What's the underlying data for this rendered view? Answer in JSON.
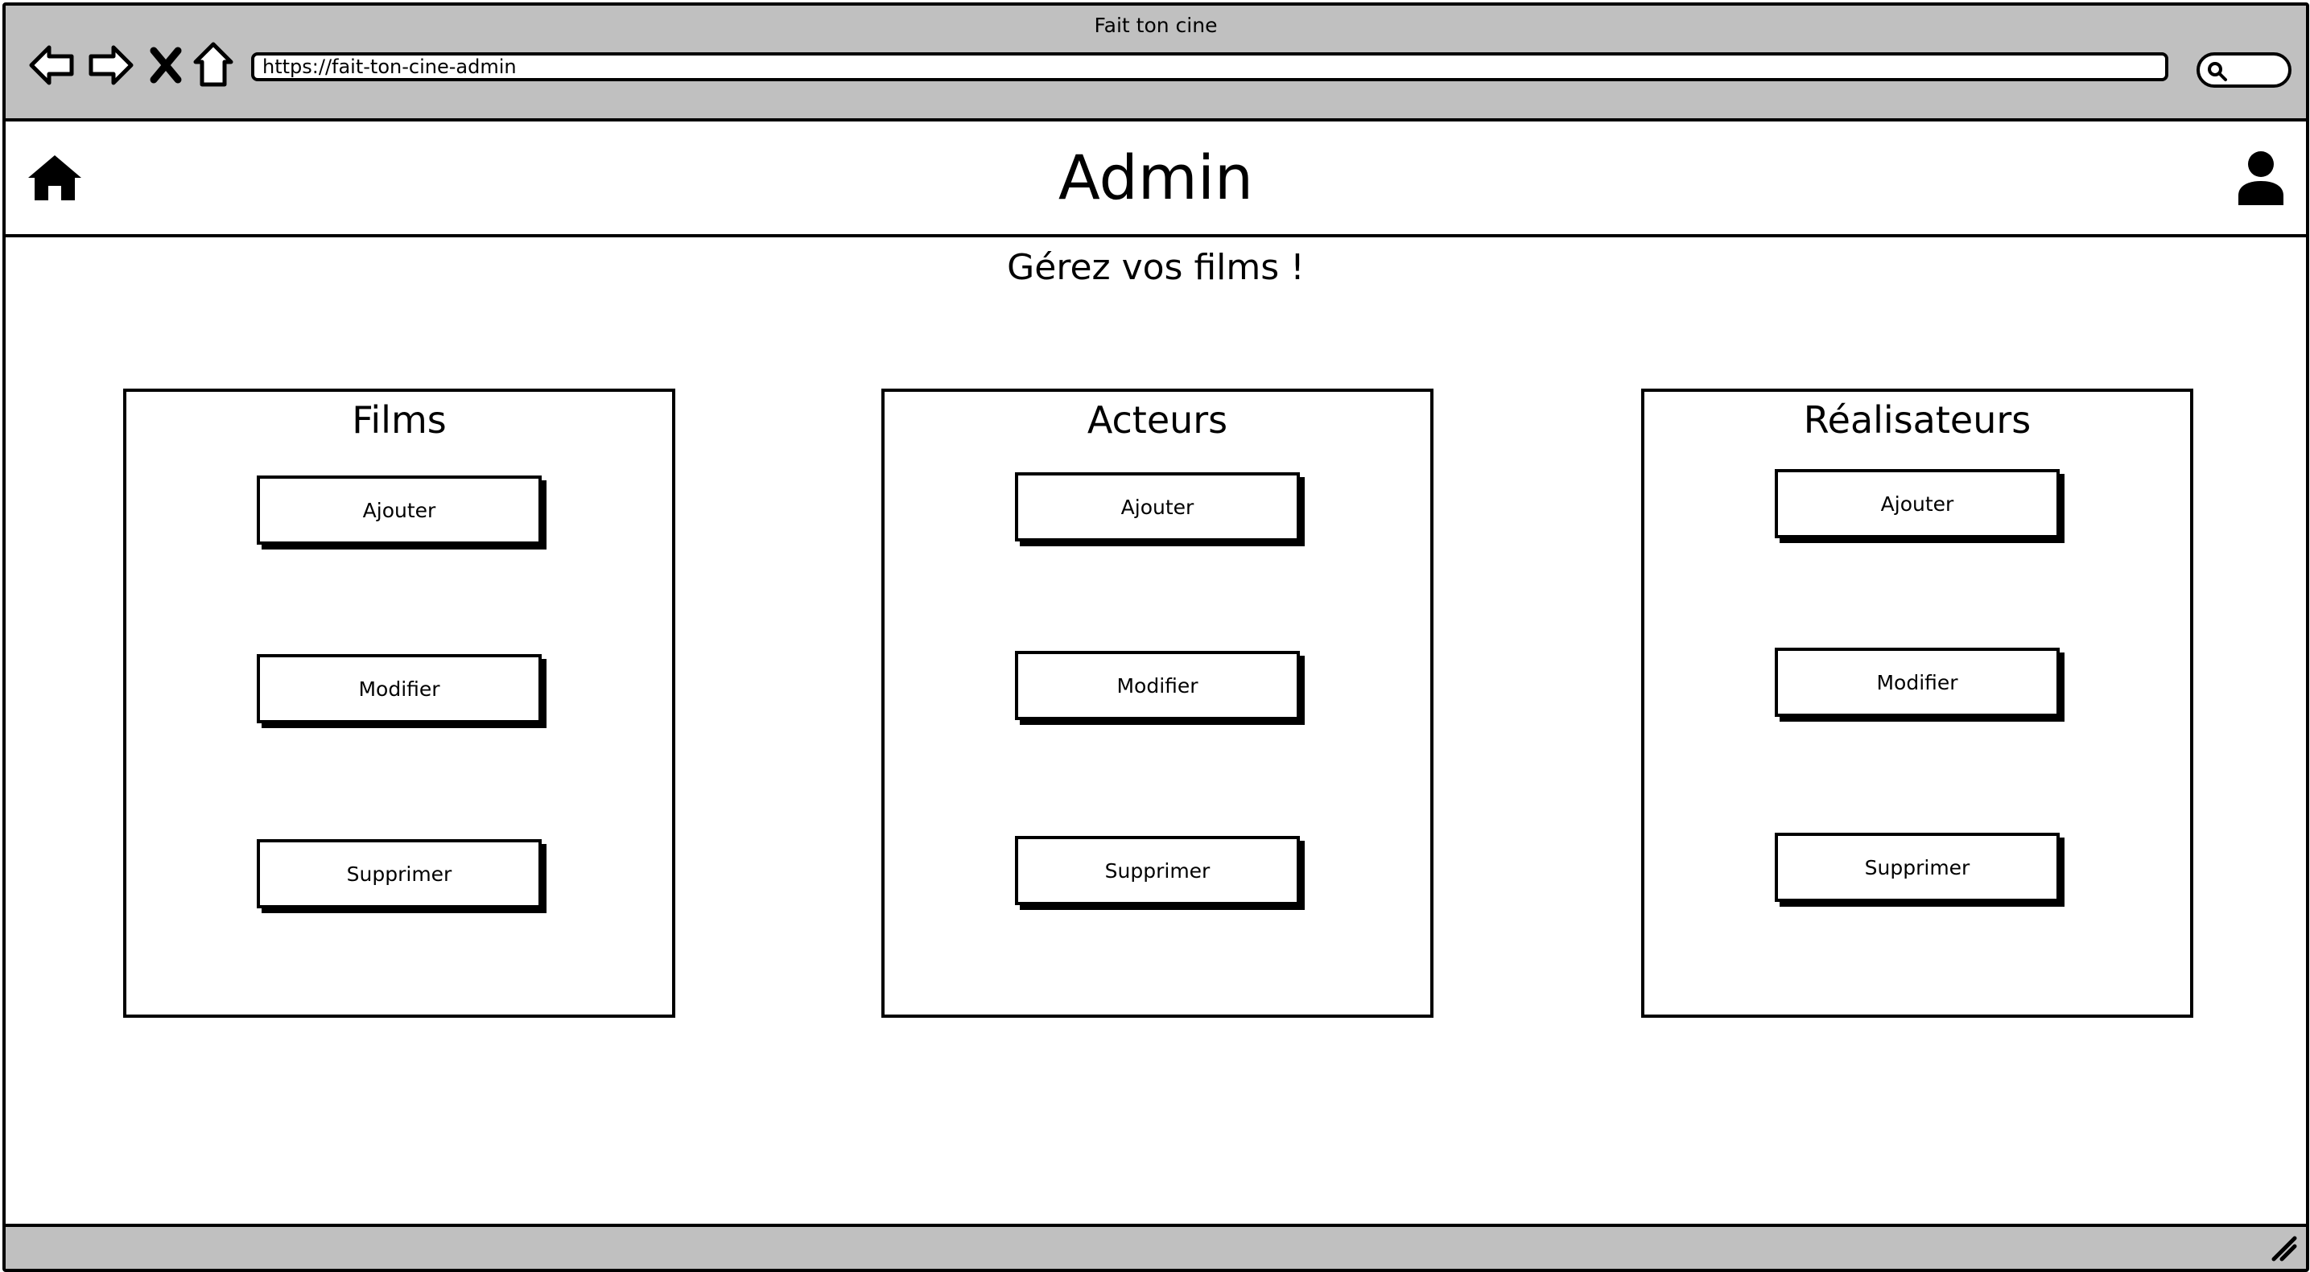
{
  "browser": {
    "window_title": "Fait ton cine",
    "url": "https://fait-ton-cine-admin"
  },
  "header": {
    "title": "Admin"
  },
  "subtitle": "Gérez vos films !",
  "panels": [
    {
      "title": "Films",
      "add_label": "Ajouter",
      "edit_label": "Modifier",
      "delete_label": "Supprimer"
    },
    {
      "title": "Acteurs",
      "add_label": "Ajouter",
      "edit_label": "Modifier",
      "delete_label": "Supprimer"
    },
    {
      "title": "Réalisateurs",
      "add_label": "Ajouter",
      "edit_label": "Modifier",
      "delete_label": "Supprimer"
    }
  ],
  "icons": {
    "back": "back-arrow-icon",
    "forward": "forward-arrow-icon",
    "stop": "close-icon",
    "home_nav": "home-outline-icon",
    "search": "search-icon",
    "home": "home-icon",
    "user": "user-icon",
    "resize": "resize-grip-icon"
  },
  "colors": {
    "chrome": "#c0c0c0",
    "border": "#000000",
    "background": "#ffffff"
  }
}
